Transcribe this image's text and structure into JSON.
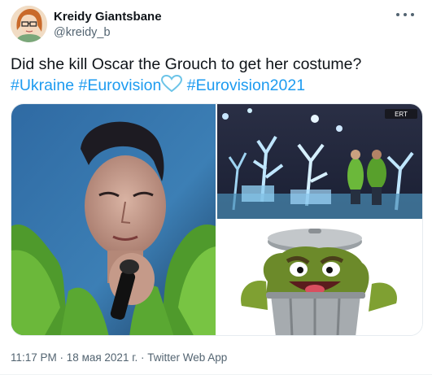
{
  "author": {
    "display_name": "Kreidy Giantsbane",
    "handle": "@kreidy_b"
  },
  "more_icon": "more-horizontal-icon",
  "tweet": {
    "text": "Did she kill Oscar the Grouch to get her costume?",
    "hashtags": [
      "#Ukraine",
      "#Eurovision",
      "#Eurovision2021"
    ],
    "emoji_icon": "light-blue-heart-icon"
  },
  "media": {
    "images": [
      "singer-closeup-photo",
      "stage-performance-photo",
      "oscar-the-grouch-photo"
    ],
    "overlay_text": "ERT"
  },
  "footer": {
    "time": "11:17 PM",
    "separator": " · ",
    "date": "18 мая 2021 г.",
    "source": "Twitter Web App"
  },
  "colors": {
    "text": "#0f1419",
    "secondary": "#536471",
    "link": "#1d9bf0",
    "heart": "#6cc4e8"
  }
}
